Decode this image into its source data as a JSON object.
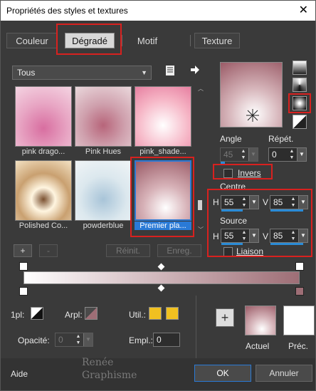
{
  "window": {
    "title": "Propriétés des styles et textures",
    "close_glyph": "✕"
  },
  "tabs": [
    {
      "label": "Couleur"
    },
    {
      "label": "Dégradé"
    },
    {
      "label": "Motif"
    },
    {
      "label": "Texture"
    }
  ],
  "category_select": {
    "value": "Tous"
  },
  "thumbnails": [
    {
      "caption": "pink drago..."
    },
    {
      "caption": "Pink Hues"
    },
    {
      "caption": "pink_shade..."
    },
    {
      "caption": "Polished Co..."
    },
    {
      "caption": "powderblue"
    },
    {
      "caption": "Premier pla..."
    }
  ],
  "list_buttons": {
    "add": "+",
    "remove": "-",
    "reset": "Réinit.",
    "save": "Enreg."
  },
  "angle": {
    "label": "Angle",
    "value": "45"
  },
  "repeat": {
    "label": "Répét.",
    "value": "0"
  },
  "invert": {
    "label": "Invers",
    "checked": false
  },
  "centre": {
    "label": "Centre",
    "h_label": "H",
    "h_value": "55",
    "v_label": "V",
    "v_value": "85"
  },
  "source": {
    "label": "Source",
    "h_label": "H",
    "h_value": "55",
    "v_label": "V",
    "v_value": "85"
  },
  "link": {
    "label": "Liaison",
    "checked": false
  },
  "stop_props": {
    "label_1pl": "1pl:",
    "label_arpl": "Arpl:",
    "label_util": "Util.:",
    "label_opacity": "Opacité:",
    "opacity_value": "0",
    "label_empl": "Empl.:",
    "empl_value": "0"
  },
  "preview": {
    "add": "+",
    "current_label": "Actuel",
    "previous_label": "Préc."
  },
  "footer": {
    "help": "Aide",
    "ok": "OK",
    "cancel": "Annuler",
    "watermark_line1": "Renée",
    "watermark_line2": "Graphisme"
  },
  "colors": {
    "accent": "#2a7ad6",
    "highlight": "#d8211f",
    "swatch_yellow": "#f0c020"
  }
}
